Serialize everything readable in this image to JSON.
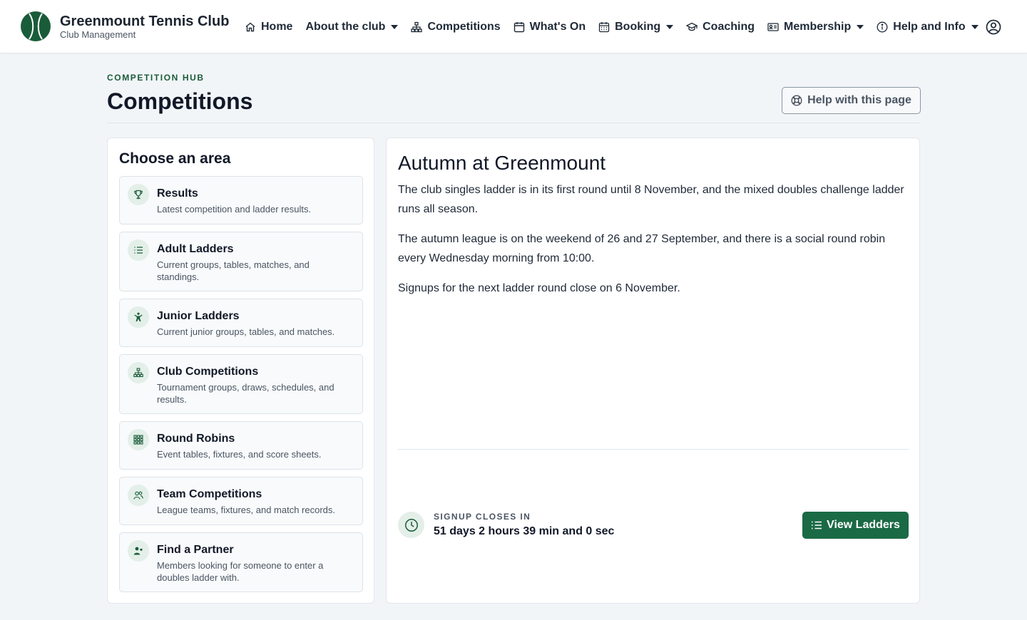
{
  "brand": {
    "name": "Greenmount Tennis Club",
    "subtitle": "Club Management",
    "accent_color": "#1a5c3a"
  },
  "nav": {
    "items": [
      {
        "label": "Home",
        "icon": "home-icon",
        "dropdown": false
      },
      {
        "label": "About the club",
        "icon": null,
        "dropdown": true
      },
      {
        "label": "Competitions",
        "icon": "sitemap-icon",
        "dropdown": false
      },
      {
        "label": "What's On",
        "icon": "calendar-icon",
        "dropdown": false
      },
      {
        "label": "Booking",
        "icon": "calendar-grid-icon",
        "dropdown": true
      },
      {
        "label": "Coaching",
        "icon": "graduation-cap-icon",
        "dropdown": false
      },
      {
        "label": "Membership",
        "icon": "id-card-icon",
        "dropdown": true
      },
      {
        "label": "Help and Info",
        "icon": "info-icon",
        "dropdown": true
      }
    ],
    "user_icon": "user-circle-icon"
  },
  "header": {
    "eyebrow": "COMPETITION HUB",
    "title": "Competitions",
    "help_button": "Help with this page"
  },
  "areas": {
    "title": "Choose an area",
    "items": [
      {
        "title": "Results",
        "desc": "Latest competition and ladder results.",
        "icon": "trophy-icon"
      },
      {
        "title": "Adult Ladders",
        "desc": "Current groups, tables, matches, and standings.",
        "icon": "list-icon"
      },
      {
        "title": "Junior Ladders",
        "desc": "Current junior groups, tables, and matches.",
        "icon": "child-icon"
      },
      {
        "title": "Club Competitions",
        "desc": "Tournament groups, draws, schedules, and results.",
        "icon": "sitemap-icon"
      },
      {
        "title": "Round Robins",
        "desc": "Event tables, fixtures, and score sheets.",
        "icon": "grid-icon"
      },
      {
        "title": "Team Competitions",
        "desc": "League teams, fixtures, and match records.",
        "icon": "people-icon"
      },
      {
        "title": "Find a Partner",
        "desc": "Members looking for someone to enter a doubles ladder with.",
        "icon": "person-heart-icon"
      }
    ]
  },
  "feature": {
    "title": "Autumn at Greenmount",
    "paragraphs": [
      "The club singles ladder is in its first round until 8 November, and the mixed doubles challenge ladder runs all season.",
      "The autumn league is on the weekend of 26 and 27 September, and there is a social round robin every Wednesday morning from 10:00.",
      "Signups for the next ladder round close on 6 November."
    ],
    "countdown_label": "SIGNUP CLOSES IN",
    "countdown_value": "51 days 2 hours 39 min and 0 sec",
    "countdown_icon": "clock-icon",
    "button_label": "View Ladders",
    "button_color": "#1a6a45"
  }
}
